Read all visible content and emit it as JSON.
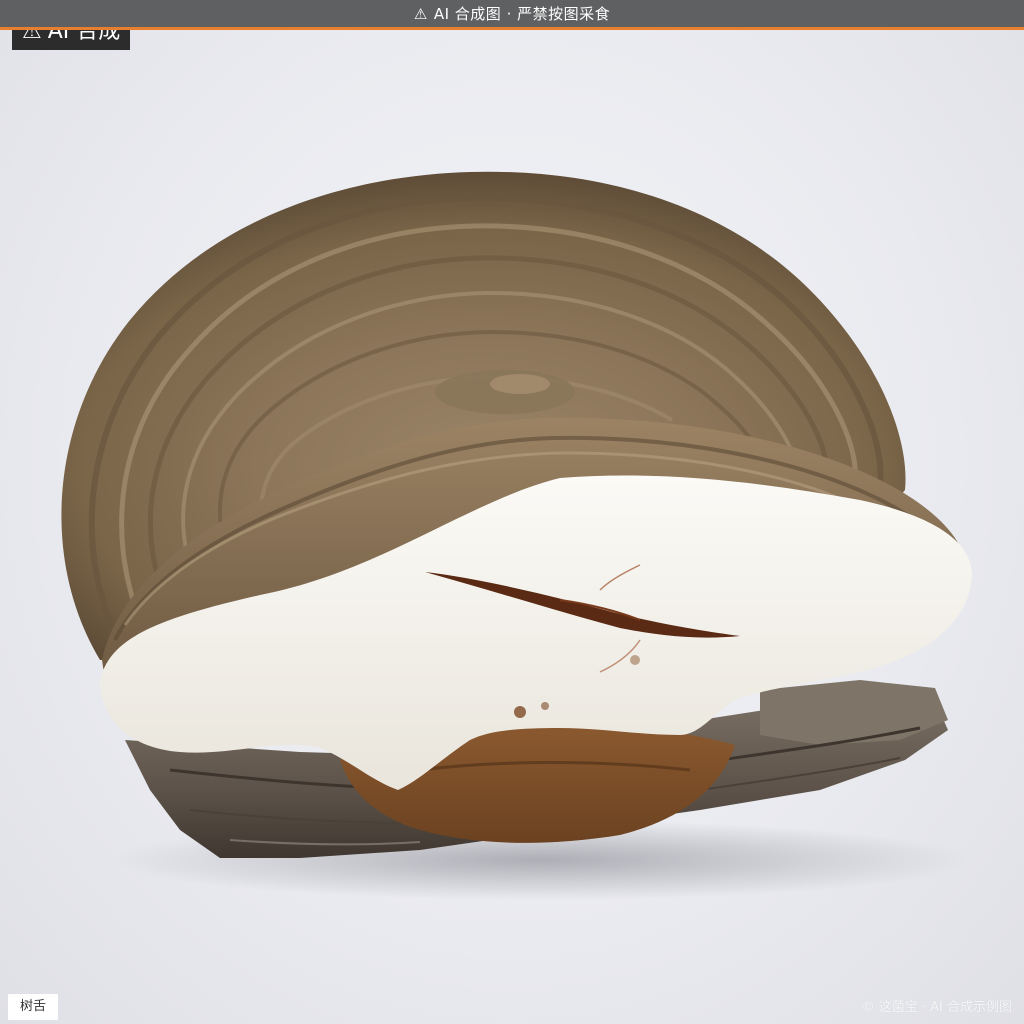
{
  "banner": {
    "icon": "warning-icon",
    "text": "AI 合成图 · 严禁按图采食"
  },
  "badge": {
    "icon": "warning-icon",
    "text": "AI 合成"
  },
  "image": {
    "subject": "树舌",
    "colors": {
      "background": "#e9eaef",
      "cap_top": "#8a7558",
      "pore_surface": "#f3f1ec",
      "wood": "#6b6258",
      "banner": "#5e6062",
      "banner_accent": "#e87e2e"
    }
  },
  "caption": {
    "label": "树舌"
  },
  "watermark": {
    "text": "© 这菌宝 · AI 合成示例图"
  }
}
